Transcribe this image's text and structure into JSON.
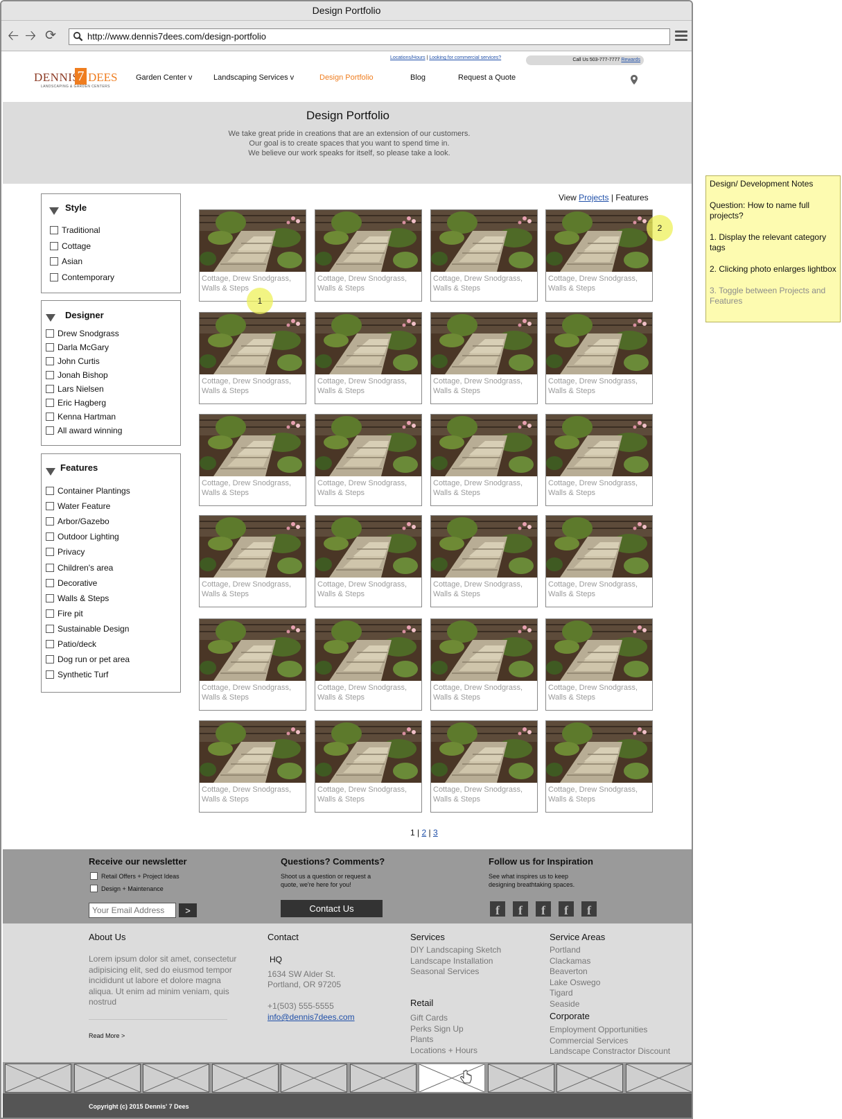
{
  "browser": {
    "title": "Design Portfolio",
    "url": "http://www.dennis7dees.com/design-portfolio"
  },
  "header": {
    "util_links": [
      "Locations/Hours",
      "Looking for commercial services?"
    ],
    "call": "Call Us 503-777-7777",
    "rewards": "Rewards",
    "logo": {
      "left": "DENNIS'",
      "seven": "7",
      "right": "DEES",
      "tagline": "LANDSCAPING & GARDEN CENTERS"
    },
    "nav": [
      "Garden Center v",
      "Landscaping Services v",
      "Design Portfolio",
      "Blog",
      "Request a Quote"
    ]
  },
  "hero": {
    "title": "Design Portfolio",
    "line1": "We take great pride in creations that are an extension of our customers. Our goal is to create spaces that you want to spend time in.",
    "line2": "We believe our work speaks for itself, so please take a look."
  },
  "filters": {
    "style": {
      "title": "Style",
      "options": [
        "Traditional",
        "Cottage",
        "Asian",
        "Contemporary"
      ]
    },
    "designer": {
      "title": "Designer",
      "options": [
        "Drew Snodgrass",
        "Darla McGary",
        "John Curtis",
        "Jonah Bishop",
        "Lars Nielsen",
        "Eric Hagberg",
        "Kenna Hartman",
        "All award winning"
      ]
    },
    "features": {
      "title": "Features",
      "options": [
        "Container Plantings",
        "Water Feature",
        "Arbor/Gazebo",
        "Outdoor Lighting",
        "Privacy",
        "Children's area",
        "Decorative",
        "Walls & Steps",
        "Fire pit",
        "Sustainable Design",
        "Patio/deck",
        "Dog run or pet area",
        "Synthetic Turf"
      ]
    }
  },
  "view_toggle": {
    "prefix": "View",
    "projects": "Projects",
    "sep": "|",
    "features": "Features"
  },
  "gallery": {
    "caption_line1": "Cottage, Drew Snodgrass,",
    "caption_line2": "Walls & Steps",
    "rows": 6,
    "cols": 4
  },
  "markers": [
    "1",
    "2"
  ],
  "pager": {
    "current": "1",
    "pages": [
      "2",
      "3"
    ],
    "sep": "|"
  },
  "newsletter": {
    "title": "Receive our newsletter",
    "options": [
      "Retail Offers + Project Ideas",
      "Design + Maintenance"
    ],
    "email_placeholder": "Your Email Address",
    "submit": ">"
  },
  "questions": {
    "title": "Questions? Comments?",
    "text": "Shoot us a question or request a quote, we're here for you!",
    "button": "Contact Us"
  },
  "follow": {
    "title": "Follow us for Inspiration",
    "text": "See what inspires us to keep designing breathtaking spaces.",
    "icon_letter": "f"
  },
  "footer": {
    "about": {
      "title": "About Us",
      "text": "Lorem ipsum dolor sit amet, consectetur adipisicing elit, sed do eiusmod tempor incididunt ut labore et dolore magna aliqua. Ut enim ad minim veniam, quis nostrud",
      "more": "Read More >"
    },
    "contact": {
      "title": "Contact",
      "hq": "HQ",
      "address1": "1634 SW Alder St.",
      "address2": "Portland, OR 97205",
      "phone": "+1(503) 555-5555",
      "email": "info@dennis7dees.com"
    },
    "services": {
      "title": "Services",
      "items": [
        "DIY Landscaping Sketch",
        "Landscape Installation",
        "Seasonal Services"
      ]
    },
    "retail": {
      "title": "Retail",
      "items": [
        "Gift Cards",
        "Perks Sign Up",
        "Plants",
        "Locations + Hours"
      ]
    },
    "service_areas": {
      "title": "Service Areas",
      "items": [
        "Portland",
        "Clackamas",
        "Beaverton",
        "Lake Oswego",
        "Tigard",
        "Seaside"
      ]
    },
    "corporate": {
      "title": "Corporate",
      "items": [
        "Employment Opportunities",
        "Commercial Services",
        "Landscape Constractor Discount"
      ]
    }
  },
  "copyright": "Copyright (c) 2015 Dennis' 7 Dees",
  "note": {
    "title": "Design/ Development Notes",
    "question": "Question: How to name full projects?",
    "item1": "1. Display the relevant category tags",
    "item2": "2. Clicking photo enlarges lightbox",
    "item3": "3. Toggle between Projects and Features"
  },
  "colors": {
    "accent": "#ef7d1f",
    "link": "#1f4fa8",
    "note": "#fdfbb0",
    "marker": "#eef05a"
  }
}
